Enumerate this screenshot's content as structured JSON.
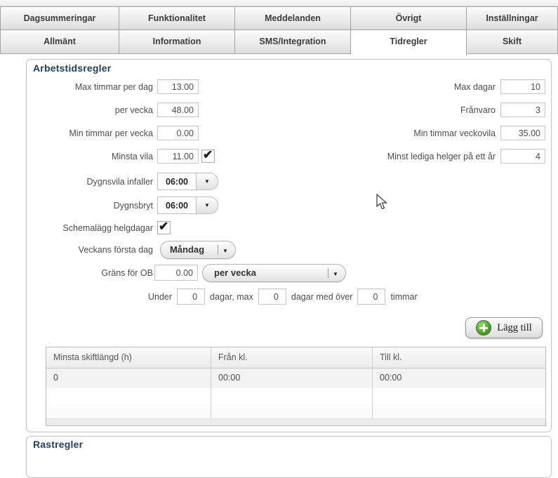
{
  "tabs": {
    "row1": [
      "Dagsummeringar",
      "Funktionalitet",
      "Meddelanden",
      "Övrigt",
      "Inställningar"
    ],
    "row2": [
      "Allmänt",
      "Information",
      "SMS/Integration",
      "Tidregler",
      "Skift"
    ],
    "active_tab": "Tidregler"
  },
  "colors": {
    "section_title": "#1e3c5c",
    "add_icon_green": "#46a61f"
  },
  "work_rules": {
    "title": "Arbetstidsregler",
    "left": {
      "max_hours_per_day": {
        "label": "Max timmar per dag",
        "value": "13.00"
      },
      "per_week": {
        "label": "per vecka",
        "value": "48.00"
      },
      "min_hours_per_week": {
        "label": "Min timmar per vecka",
        "value": "0.00"
      },
      "min_rest": {
        "label": "Minsta vila",
        "value": "11.00",
        "checked": true
      },
      "daily_rest_occurs": {
        "label": "Dygnsvila infaller",
        "value": "06:00"
      },
      "day_break": {
        "label": "Dygnsbryt",
        "value": "06:00"
      },
      "schedule_holidays": {
        "label": "Schemalägg helgdagar",
        "checked": true
      },
      "first_day_of_week": {
        "label": "Veckans första dag",
        "value": "Måndag"
      },
      "ob_limit": {
        "label": "Gräns för OB",
        "value": "0.00",
        "period": "per vecka"
      }
    },
    "right": {
      "max_days": {
        "label": "Max dagar",
        "value": "10"
      },
      "absence": {
        "label": "Frånvaro",
        "value": "3"
      },
      "min_weekly_rest": {
        "label": "Min timmar veckovila",
        "value": "35.00"
      },
      "min_free_weekends": {
        "label": "Minst lediga helger på ett år",
        "value": "4"
      }
    },
    "under_rule": {
      "prefix": "Under",
      "days_value": "0",
      "middle": "dagar, max",
      "max_value": "0",
      "suffix": "dagar med över",
      "hours_value": "0",
      "end": "timmar"
    },
    "add_button": "Lägg till",
    "table": {
      "headers": [
        "Minsta skiftlängd (h)",
        "Från kl.",
        "Till kl."
      ],
      "rows": [
        [
          "0",
          "00:00",
          "00:00"
        ]
      ]
    }
  },
  "rest_rules": {
    "title": "Rastregler"
  }
}
